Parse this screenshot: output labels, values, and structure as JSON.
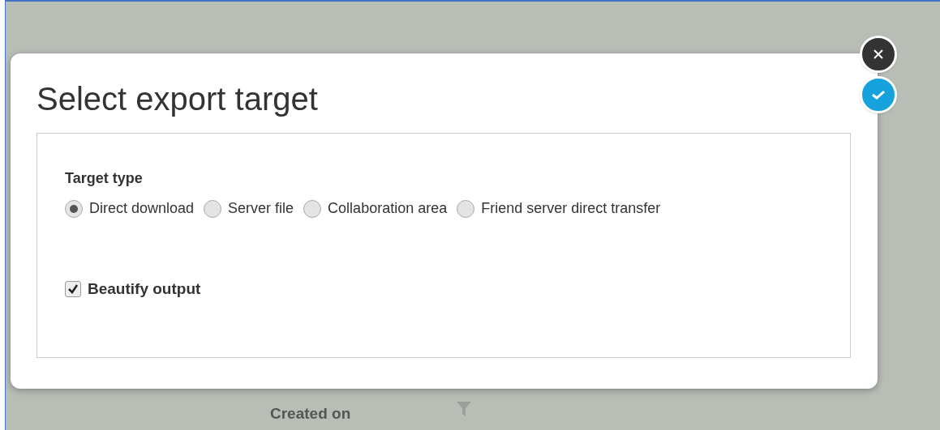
{
  "background": {
    "column_header": "Created on"
  },
  "dialog": {
    "title": "Select export target",
    "actions": [
      {
        "kind": "close"
      },
      {
        "kind": "confirm"
      }
    ],
    "target_type": {
      "label": "Target type",
      "options": [
        {
          "label": "Direct download",
          "selected": true
        },
        {
          "label": "Server file",
          "selected": false
        },
        {
          "label": "Collaboration area",
          "selected": false
        },
        {
          "label": "Friend server direct transfer",
          "selected": false
        }
      ]
    },
    "beautify": {
      "label": "Beautify output",
      "checked": true
    }
  }
}
